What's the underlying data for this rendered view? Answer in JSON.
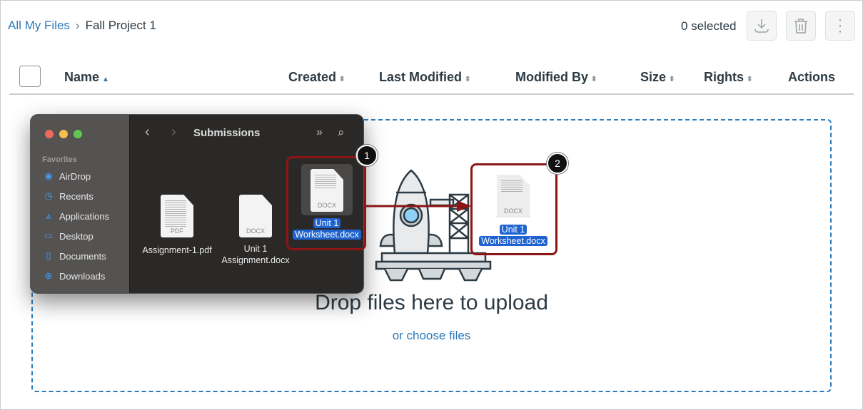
{
  "breadcrumb": {
    "root": "All My Files",
    "current": "Fall Project 1"
  },
  "toolbar": {
    "selected": "0 selected",
    "icons": [
      "download-icon",
      "trash-icon",
      "more-vertical-icon"
    ]
  },
  "columns": [
    {
      "label": "Name",
      "sort": "▲"
    },
    {
      "label": "Created",
      "sort": "⬍"
    },
    {
      "label": "Last Modified",
      "sort": "⬍"
    },
    {
      "label": "Modified By",
      "sort": "⬍"
    },
    {
      "label": "Size",
      "sort": "⬍"
    },
    {
      "label": "Rights",
      "sort": "⬍"
    },
    {
      "label": "Actions"
    }
  ],
  "dropzone": {
    "title": "Drop files here to upload",
    "link": "or choose files"
  },
  "finder": {
    "title": "Submissions",
    "favorites_label": "Favorites",
    "sidebar": [
      "AirDrop",
      "Recents",
      "Applications",
      "Desktop",
      "Documents",
      "Downloads"
    ],
    "files": [
      {
        "type": "PDF",
        "name": "Assignment-1.pdf"
      },
      {
        "type": "DOCX",
        "name1": "Unit 1",
        "name2": "Assignment.docx"
      },
      {
        "type": "DOCX",
        "name1": "Unit 1",
        "name2": "Worksheet.docx"
      }
    ]
  },
  "dragged": {
    "type": "DOCX",
    "name1": "Unit 1",
    "name2": "Worksheet.docx"
  },
  "callouts": [
    "1",
    "2"
  ],
  "colors": {
    "link": "#2b7abc",
    "callout": "#8c1515",
    "selection": "#1f63d0"
  }
}
